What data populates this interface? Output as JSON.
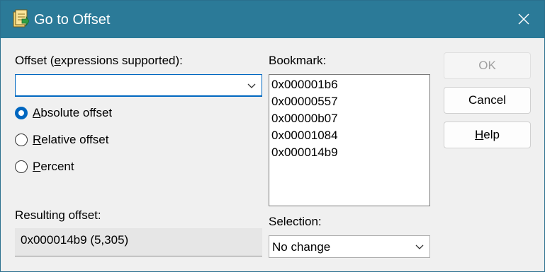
{
  "window": {
    "title": "Go to Offset",
    "title_bar_color": "#2b7a98"
  },
  "offset": {
    "label_prefix": "Offset (",
    "label_accel": "e",
    "label_suffix": "xpressions supported):",
    "value": ""
  },
  "radios": [
    {
      "accel": "A",
      "rest": "bsolute offset",
      "checked": true
    },
    {
      "accel": "R",
      "rest": "elative offset",
      "checked": false
    },
    {
      "accel": "P",
      "rest": "ercent",
      "checked": false
    }
  ],
  "result": {
    "label": "Resulting offset:",
    "value": "0x000014b9 (5,305)"
  },
  "bookmark": {
    "label": "Bookmark:",
    "items": [
      "0x000001b6",
      "0x00000557",
      "0x00000b07",
      "0x00001084",
      "0x000014b9"
    ]
  },
  "selection": {
    "label": "Selection:",
    "value": "No change"
  },
  "buttons": {
    "ok": "OK",
    "cancel": "Cancel",
    "help_accel": "H",
    "help_rest": "elp"
  },
  "colors": {
    "accent": "#0067c0"
  }
}
